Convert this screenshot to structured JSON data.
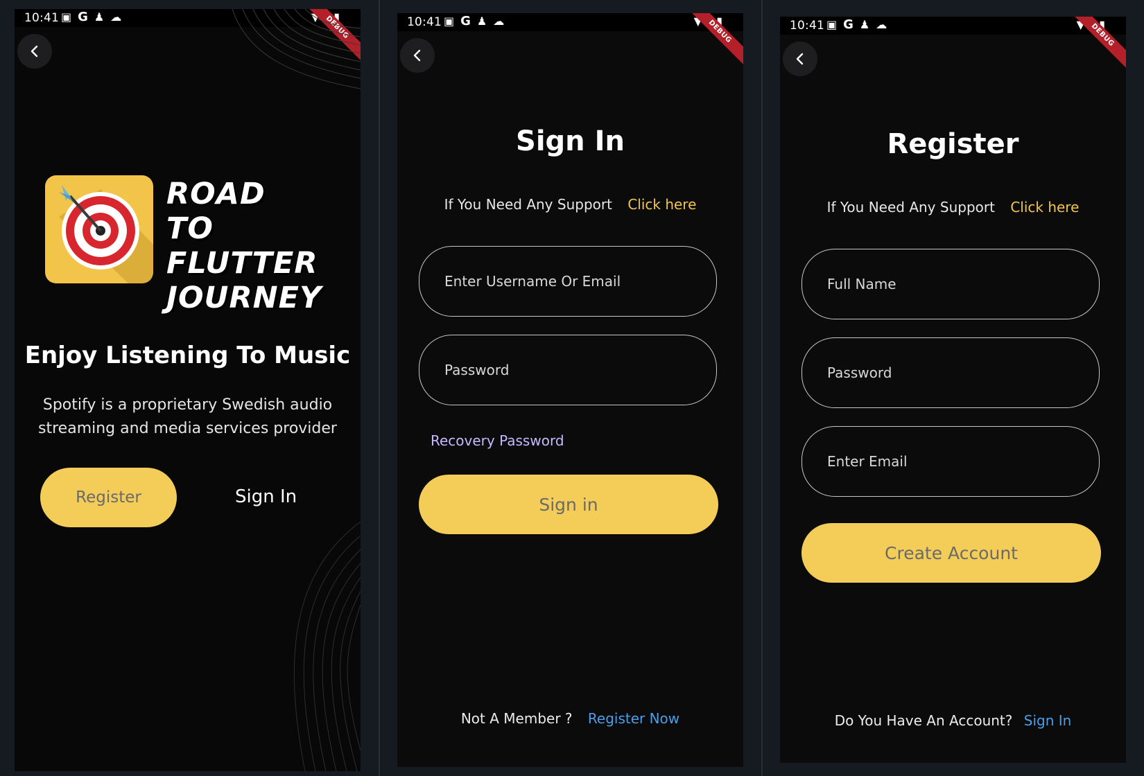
{
  "status": {
    "time": "10:41",
    "debug_label": "DEBUG"
  },
  "colors": {
    "accent_yellow": "#f4cd59",
    "link_yellow": "#f3c64a",
    "link_blue": "#4a9fe8",
    "link_purple": "#c7b8ff",
    "background": "#0b0b0c"
  },
  "welcome": {
    "logo_text": "ROAD TO\nFLUTTER\nJOURNEY",
    "headline": "Enjoy Listening To Music",
    "tagline": "Spotify is a proprietary Swedish audio streaming and media services provider",
    "register_label": "Register",
    "signin_label": "Sign In"
  },
  "signin": {
    "title": "Sign In",
    "support_text": "If You Need Any Support",
    "support_link": "Click here",
    "username_placeholder": "Enter Username Or Email",
    "password_placeholder": "Password",
    "recovery_label": "Recovery Password",
    "submit_label": "Sign in",
    "footer_text": "Not A Member ?",
    "footer_link": "Register Now"
  },
  "register": {
    "title": "Register",
    "support_text": "If You Need Any Support",
    "support_link": "Click here",
    "fullname_placeholder": "Full Name",
    "password_placeholder": "Password",
    "email_placeholder": "Enter Email",
    "submit_label": "Create Account",
    "footer_text": "Do You Have An Account?",
    "footer_link": "Sign In"
  }
}
